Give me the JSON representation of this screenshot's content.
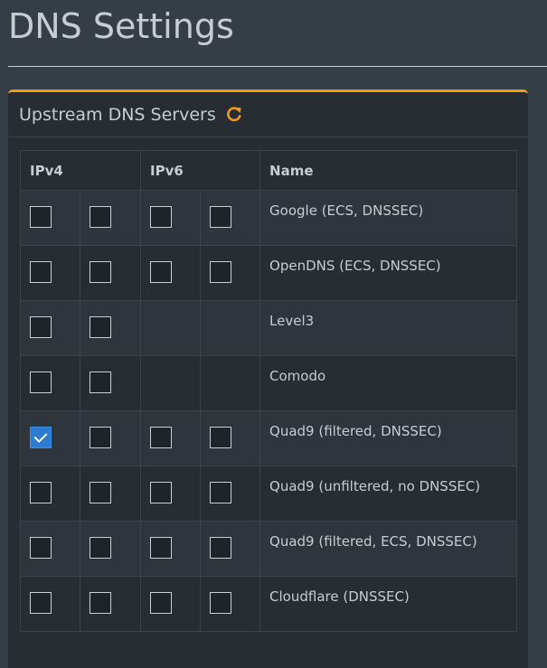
{
  "page": {
    "title": "DNS Settings"
  },
  "upstream": {
    "title": "Upstream DNS Servers",
    "refresh_icon": "refresh-icon",
    "accent_color": "#f39c12",
    "headers": {
      "ipv4": "IPv4",
      "ipv6": "IPv6",
      "name": "Name"
    },
    "servers": [
      {
        "name": "Google (ECS, DNSSEC)",
        "ipv4": [
          false,
          false
        ],
        "ipv6": [
          false,
          false
        ]
      },
      {
        "name": "OpenDNS (ECS, DNSSEC)",
        "ipv4": [
          false,
          false
        ],
        "ipv6": [
          false,
          false
        ]
      },
      {
        "name": "Level3",
        "ipv4": [
          false,
          false
        ],
        "ipv6": []
      },
      {
        "name": "Comodo",
        "ipv4": [
          false,
          false
        ],
        "ipv6": []
      },
      {
        "name": "Quad9 (filtered, DNSSEC)",
        "ipv4": [
          true,
          false
        ],
        "ipv6": [
          false,
          false
        ]
      },
      {
        "name": "Quad9 (unfiltered, no DNSSEC)",
        "ipv4": [
          false,
          false
        ],
        "ipv6": [
          false,
          false
        ]
      },
      {
        "name": "Quad9 (filtered, ECS, DNSSEC)",
        "ipv4": [
          false,
          false
        ],
        "ipv6": [
          false,
          false
        ]
      },
      {
        "name": "Cloudflare (DNSSEC)",
        "ipv4": [
          false,
          false
        ],
        "ipv6": [
          false,
          false
        ]
      }
    ]
  }
}
